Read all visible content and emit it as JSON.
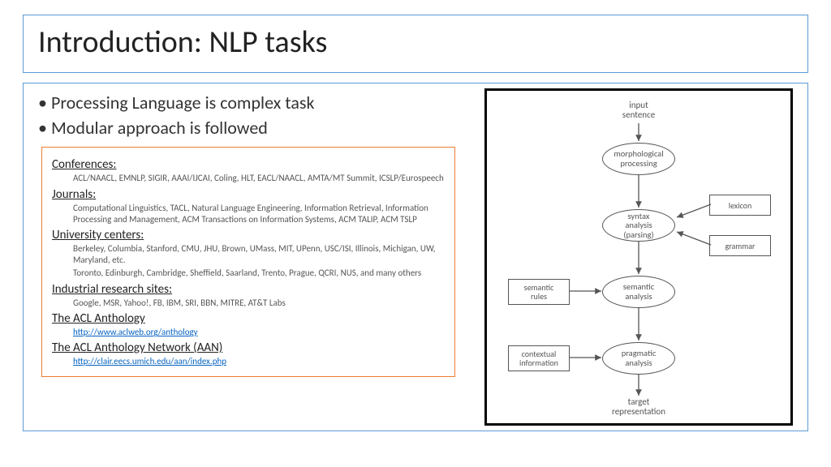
{
  "title": "Introduction: NLP tasks",
  "bullets": [
    "Processing Language is complex task",
    "Modular approach is followed"
  ],
  "resources": {
    "conferences": {
      "heading": "Conferences",
      "body": "ACL/NAACL, EMNLP, SIGIR, AAAI/IJCAI, Coling, HLT, EACL/NAACL, AMTA/MT Summit, ICSLP/Eurospeech"
    },
    "journals": {
      "heading": "Journals",
      "body": "Computational Linguistics, TACL, Natural Language Engineering, Information Retrieval, Information Processing and Management, ACM Transactions on Information Systems, ACM TALIP, ACM TSLP"
    },
    "universities": {
      "heading": "University centers",
      "body1": "Berkeley, Columbia, Stanford, CMU, JHU, Brown, UMass, MIT, UPenn, USC/ISI, Illinois, Michigan, UW, Maryland, etc.",
      "body2": "Toronto, Edinburgh, Cambridge, Sheffield, Saarland, Trento, Prague, QCRI, NUS, and many others"
    },
    "industrial": {
      "heading": "Industrial research sites",
      "body": "Google, MSR, Yahoo!, FB, IBM, SRI, BBN, MITRE, AT&T Labs"
    },
    "anthology": {
      "heading": "The ACL Anthology",
      "url": "http://www.aclweb.org/anthology"
    },
    "aan": {
      "heading": "The ACL Anthology Network (AAN)",
      "url": "http://clair.eecs.umich.edu/aan/index.php"
    }
  },
  "diagram": {
    "input": "input\nsentence",
    "morph": "morphological\nprocessing",
    "syntax": "syntax\nanalysis\n(parsing)",
    "semantic": "semantic\nanalysis",
    "pragmatic": "pragmatic\nanalysis",
    "target": "target\nrepresentation",
    "lexicon": "lexicon",
    "grammar": "grammar",
    "semantic_rules": "semantic\nrules",
    "contextual": "contextual\ninformation"
  }
}
